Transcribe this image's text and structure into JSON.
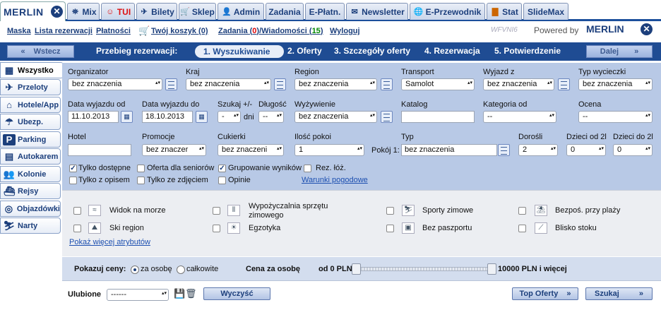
{
  "tabs": {
    "logo": "MERLIN",
    "items": [
      {
        "label": "Mix",
        "icon": "mix-icon"
      },
      {
        "label": "TUI",
        "icon": "tui-icon"
      },
      {
        "label": "Bilety",
        "icon": "plane-icon"
      },
      {
        "label": "Sklep",
        "icon": "cart-icon"
      },
      {
        "label": "Admin",
        "icon": "user-icon"
      },
      {
        "label": "Zadania",
        "icon": ""
      },
      {
        "label": "E-Płatn.",
        "icon": ""
      },
      {
        "label": "Newsletter",
        "icon": "mail-icon"
      },
      {
        "label": "E-Przewodnik",
        "icon": "globe-icon"
      },
      {
        "label": "Stat",
        "icon": "chart-icon"
      },
      {
        "label": "SlideMax",
        "icon": ""
      }
    ]
  },
  "toplinks": {
    "maska": "Maska",
    "lista": "Lista rezerwacji",
    "platnosci": "Płatności",
    "koszyk": "Twój koszyk (0)",
    "zadania_a": "Zadania (",
    "zadania_n": "0",
    "zadania_b": ")/Wiadomości (",
    "wiad_n": "15",
    "zadania_c": ")",
    "wyloguj": "Wyloguj",
    "code": "WFVNI6",
    "powered": "Powered by",
    "brand": "MERLIN"
  },
  "steps": {
    "back": "Wstecz",
    "title": "Przebieg rezerwacji:",
    "s1": "1. Wyszukiwanie",
    "s2": "2. Oferty",
    "s3": "3. Szczegóły oferty",
    "s4": "4. Rezerwacja",
    "s5": "5. Potwierdzenie",
    "next": "Dalej"
  },
  "sidebar": [
    {
      "label": "Wszystko",
      "icon": "bus-icon"
    },
    {
      "label": "Przeloty",
      "icon": "plane-icon"
    },
    {
      "label": "Hotele/App",
      "icon": "hotel-icon"
    },
    {
      "label": "Ubezp.",
      "icon": "umbrella-icon"
    },
    {
      "label": "Parking",
      "icon": "parking-icon"
    },
    {
      "label": "Autokarem",
      "icon": "bus-icon"
    },
    {
      "label": "Kolonie",
      "icon": "people-icon"
    },
    {
      "label": "Rejsy",
      "icon": "ship-icon"
    },
    {
      "label": "Objazdówki",
      "icon": "route-icon"
    },
    {
      "label": "Narty",
      "icon": "ski-icon"
    }
  ],
  "form": {
    "organizator": {
      "label": "Organizator",
      "value": "bez znaczenia"
    },
    "kraj": {
      "label": "Kraj",
      "value": "bez znaczenia"
    },
    "region": {
      "label": "Region",
      "value": "bez znaczenia"
    },
    "transport": {
      "label": "Transport",
      "value": "Samolot"
    },
    "wyjazd": {
      "label": "Wyjazd z",
      "value": "bez znaczenia"
    },
    "typ_wycieczki": {
      "label": "Typ wycieczki",
      "value": "bez znaczenia"
    },
    "data_od": {
      "label": "Data wyjazdu od",
      "value": "11.10.2013"
    },
    "data_do": {
      "label": "Data wyjazdu do",
      "value": "18.10.2013"
    },
    "szukaj": {
      "label": "Szukaj +/-",
      "value": "-",
      "unit": "dni"
    },
    "dlugosc": {
      "label": "Długość",
      "value": "--"
    },
    "wyzywienie": {
      "label": "Wyżywienie",
      "value": "bez znaczenia"
    },
    "katalog": {
      "label": "Katalog",
      "value": ""
    },
    "kategoria": {
      "label": "Kategoria od",
      "value": "--"
    },
    "ocena": {
      "label": "Ocena",
      "value": "--"
    },
    "hotel": {
      "label": "Hotel",
      "value": ""
    },
    "promocje": {
      "label": "Promocje",
      "value": "bez znaczer"
    },
    "cukierki": {
      "label": "Cukierki",
      "value": "bez znaczeni"
    },
    "pokoje": {
      "label": "Ilość pokoi",
      "value": "1"
    },
    "typ": {
      "label": "Typ",
      "room": "Pokój 1:",
      "value": "bez znaczenia"
    },
    "dorosli": {
      "label": "Dorośli",
      "value": "2"
    },
    "dzieci1": {
      "label": "Dzieci od 2l",
      "value": "0"
    },
    "dzieci2": {
      "label": "Dzieci do 2l",
      "value": "0"
    }
  },
  "checks": {
    "tylko_dostepne": "Tylko dostępne",
    "oferta_seniorow": "Oferta dla seniorów",
    "grupowanie": "Grupowanie wyników",
    "rez_loz": "Rez. łóż.",
    "tylko_opis": "Tylko z opisem",
    "tylko_zdjecie": "Tylko ze zdjęciem",
    "opinie": "Opinie",
    "warunki": "Warunki pogodowe"
  },
  "attributes": {
    "a1": "Widok na morze",
    "a2": "Wypożyczalnia sprzętu",
    "a2b": "zimowego",
    "a3": "Sporty zimowe",
    "a4": "Bezpoś. przy plaży",
    "a5": "Ski region",
    "a6": "Egzotyka",
    "a7": "Bez paszportu",
    "a8": "Blisko stoku",
    "more": "Pokaż więcej atrybutów"
  },
  "prices": {
    "label": "Pokazuj ceny:",
    "opt1": "za osobę",
    "opt2": "całkowite",
    "per": "Cena za osobę",
    "from": "od 0 PLN",
    "to": "10000 PLN i więcej"
  },
  "footer": {
    "ulubione": "Ulubione",
    "ulubione_value": "------",
    "clear": "Wyczyść",
    "top": "Top Oferty",
    "search": "Szukaj"
  }
}
